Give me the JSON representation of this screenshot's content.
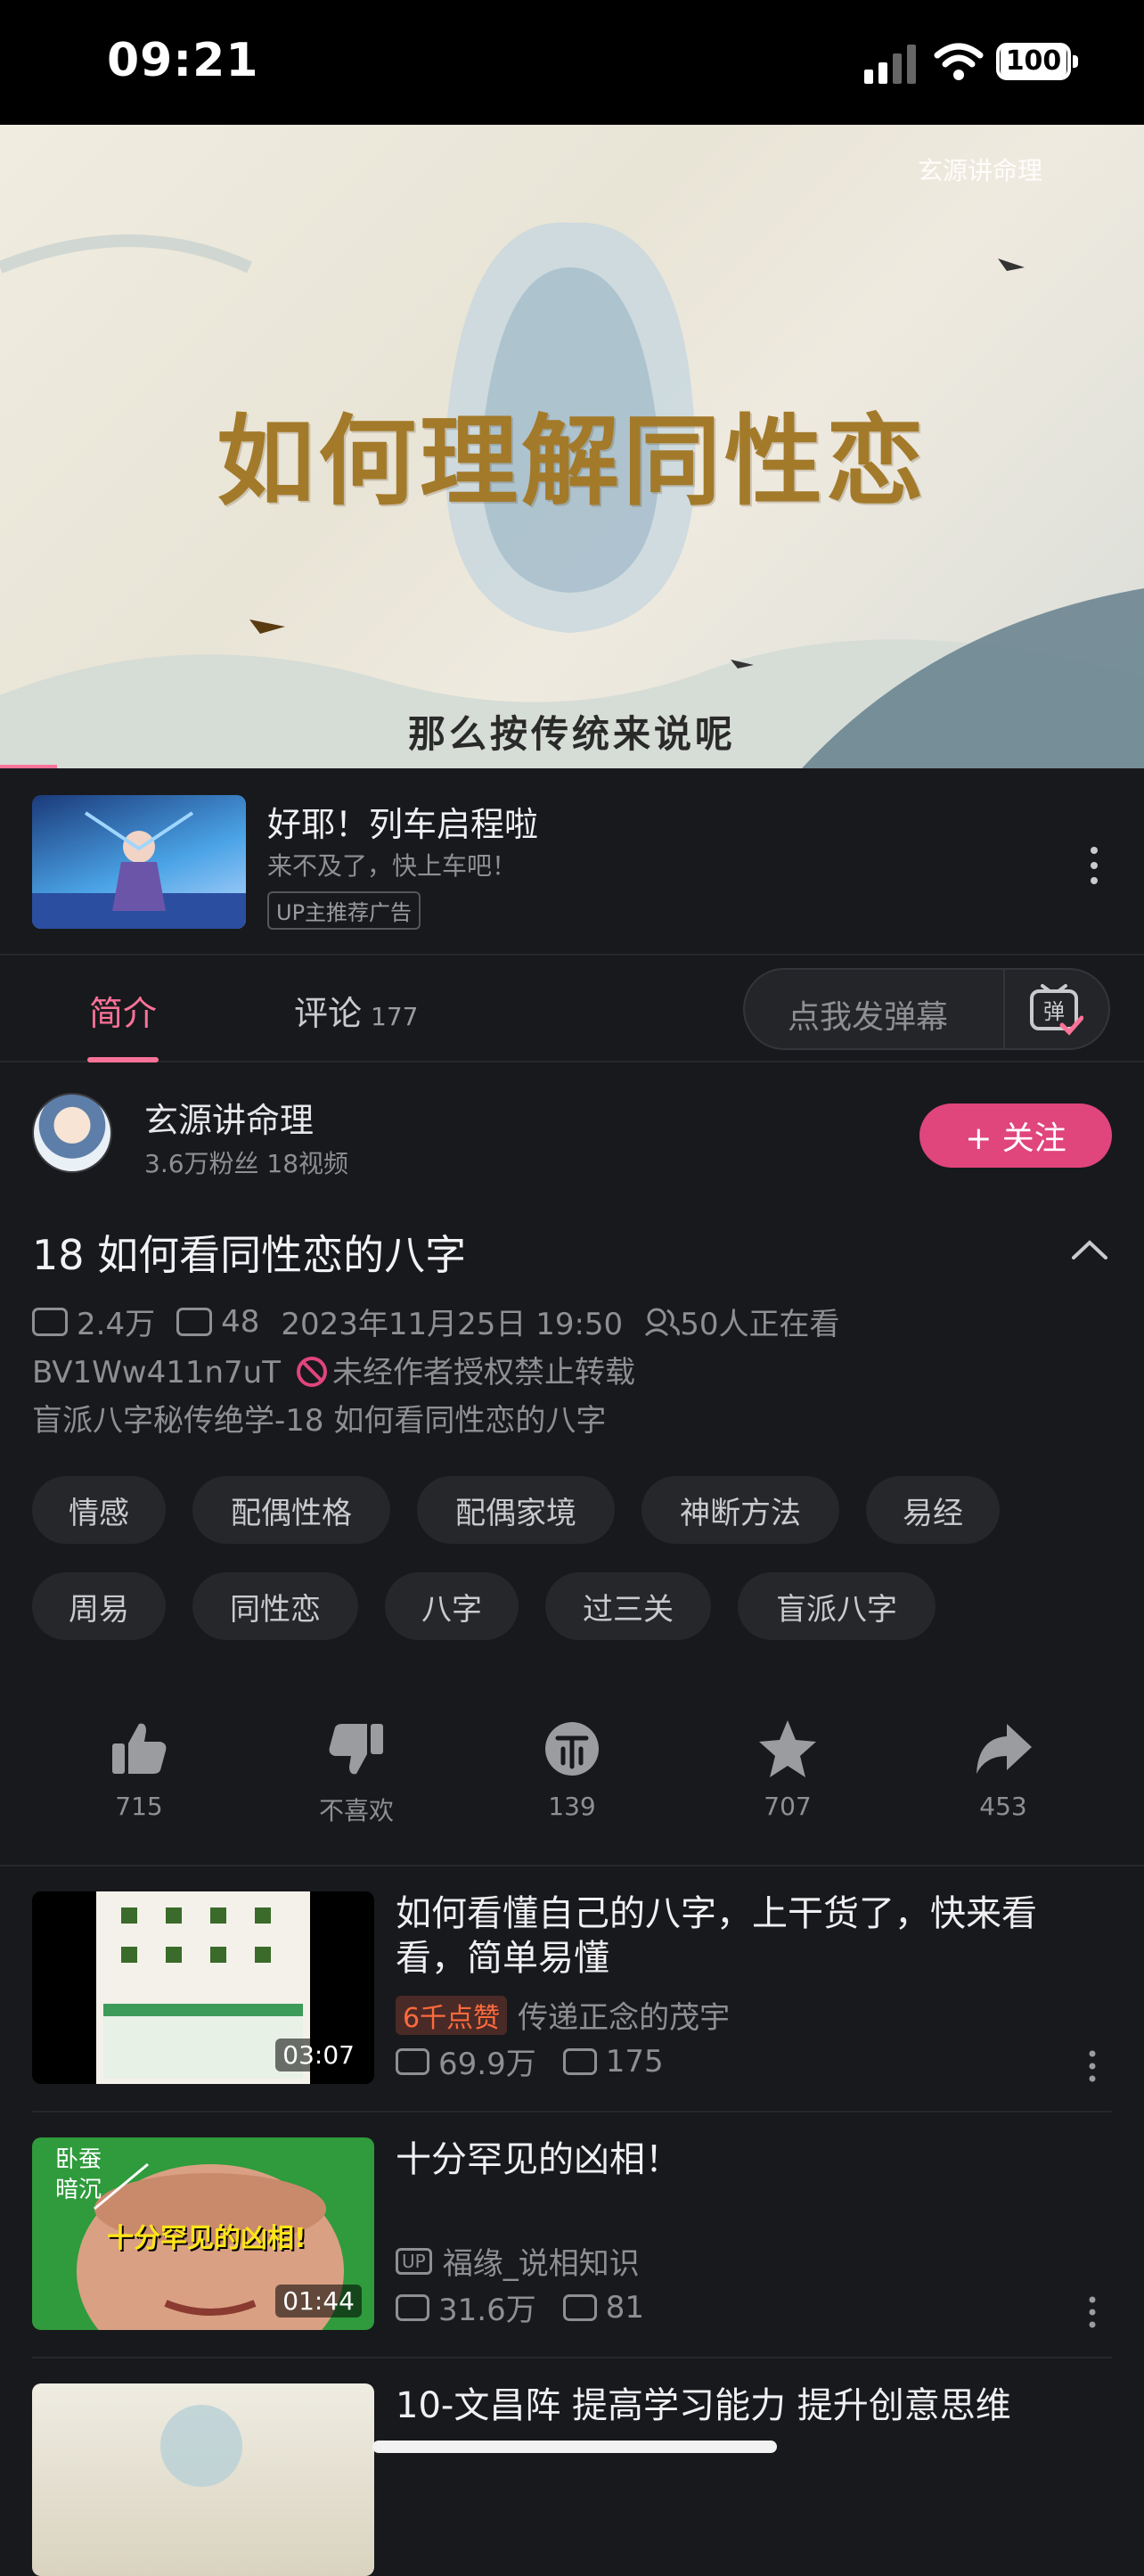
{
  "status": {
    "time": "09:21",
    "battery": "100"
  },
  "video": {
    "watermark": "玄源讲命理",
    "title_text": "如何理解同性恋",
    "subtitle_text": "那么按传统来说呢",
    "progress_fraction": 0.05
  },
  "ad": {
    "title": "好耶！列车启程啦",
    "desc": "来不及了，快上车吧！",
    "badge": "UP主推荐广告"
  },
  "tabs": {
    "intro": "简介",
    "comments": "评论",
    "comments_count": "177",
    "danmaku_placeholder": "点我发弹幕",
    "danmaku_icon_label": "弹"
  },
  "uploader": {
    "name": "玄源讲命理",
    "stats": "3.6万粉丝  18视频",
    "follow": "+ 关注"
  },
  "video_info": {
    "title": "18 如何看同性恋的八字",
    "views": "2.4万",
    "danmaku": "48",
    "date": "2023年11月25日 19:50",
    "watching": "50人正在看",
    "bvid": "BV1Ww411n7uT",
    "copyright": "未经作者授权禁止转载",
    "desc": "盲派八字秘传绝学-18 如何看同性恋的八字"
  },
  "tags": [
    "情感",
    "配偶性格",
    "配偶家境",
    "神断方法",
    "易经",
    "周易",
    "同性恋",
    "八字",
    "过三关",
    "盲派八字"
  ],
  "actions": {
    "like": "715",
    "dislike": "不喜欢",
    "coin": "139",
    "favorite": "707",
    "share": "453"
  },
  "recommendations": [
    {
      "title": "如何看懂自己的八字，上干货了，快来看看，简单易懂",
      "hot": "6千点赞",
      "author": "传递正念的茂宇",
      "views": "69.9万",
      "danmaku": "175",
      "duration": "03:07"
    },
    {
      "title": "十分罕见的凶相！",
      "author": "福缘_说相知识",
      "views": "31.6万",
      "danmaku": "81",
      "duration": "01:44",
      "thumb_text_top": "卧蚕\n暗沉",
      "thumb_caption": "十分罕见的凶相!"
    },
    {
      "title": "10-文昌阵  提高学习能力  提升创意思维"
    }
  ]
}
